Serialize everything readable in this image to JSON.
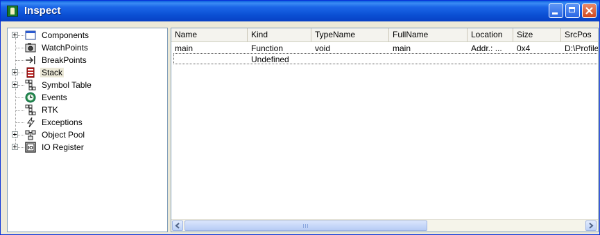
{
  "window": {
    "title": "Inspect"
  },
  "tree": {
    "items": [
      {
        "label": "Components",
        "icon": "window-icon",
        "expandable": true
      },
      {
        "label": "WatchPoints",
        "icon": "camera-icon",
        "expandable": false
      },
      {
        "label": "BreakPoints",
        "icon": "breakpoint-arrow-icon",
        "expandable": false
      },
      {
        "label": "Stack",
        "icon": "stack-icon",
        "expandable": true,
        "selected": true
      },
      {
        "label": "Symbol Table",
        "icon": "symbol-table-icon",
        "expandable": true
      },
      {
        "label": "Events",
        "icon": "clock-icon",
        "expandable": false
      },
      {
        "label": "RTK",
        "icon": "rtk-icon",
        "expandable": false
      },
      {
        "label": "Exceptions",
        "icon": "lightning-icon",
        "expandable": false
      },
      {
        "label": "Object Pool",
        "icon": "object-pool-icon",
        "expandable": true
      },
      {
        "label": "IO Register",
        "icon": "io-register-icon",
        "expandable": true
      }
    ]
  },
  "table": {
    "columns": [
      "Name",
      "Kind",
      "TypeName",
      "FullName",
      "Location",
      "Size",
      "SrcPos"
    ],
    "rows": [
      [
        "main",
        "Function",
        "void",
        "main",
        "Addr.: ...",
        "0x4",
        "D:\\Profile"
      ],
      [
        "",
        "Undefined",
        "",
        "",
        "",
        "",
        ""
      ]
    ]
  },
  "scrollbar": {
    "orientation": "horizontal"
  },
  "colors": {
    "titlebar": "#0a4fd3",
    "window_bg": "#ece9d8",
    "close_button": "#d0471f"
  }
}
